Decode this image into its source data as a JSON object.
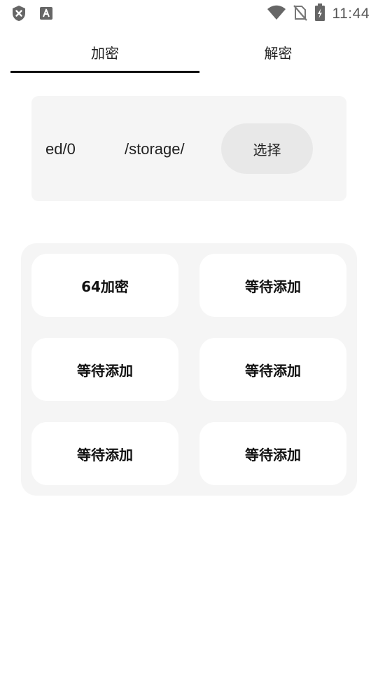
{
  "status_bar": {
    "time": "11:44",
    "icons_left": [
      "shield-x-icon",
      "text-a-icon"
    ],
    "icons_right": [
      "wifi-icon",
      "no-sim-icon",
      "battery-charging-icon"
    ]
  },
  "tabs": [
    {
      "label": "加密",
      "selected": true
    },
    {
      "label": "解密",
      "selected": false
    }
  ],
  "path_card": {
    "path_segment_1": "ed/0",
    "path_segment_2": "/storage/",
    "select_label": "选择"
  },
  "grid": {
    "buttons": [
      {
        "label": "64加密"
      },
      {
        "label": "等待添加"
      },
      {
        "label": "等待添加"
      },
      {
        "label": "等待添加"
      },
      {
        "label": "等待添加"
      },
      {
        "label": "等待添加"
      }
    ]
  },
  "colors": {
    "background": "#ffffff",
    "card": "#f5f5f5",
    "select_button": "#e8e8e8",
    "indicator": "#111111"
  }
}
